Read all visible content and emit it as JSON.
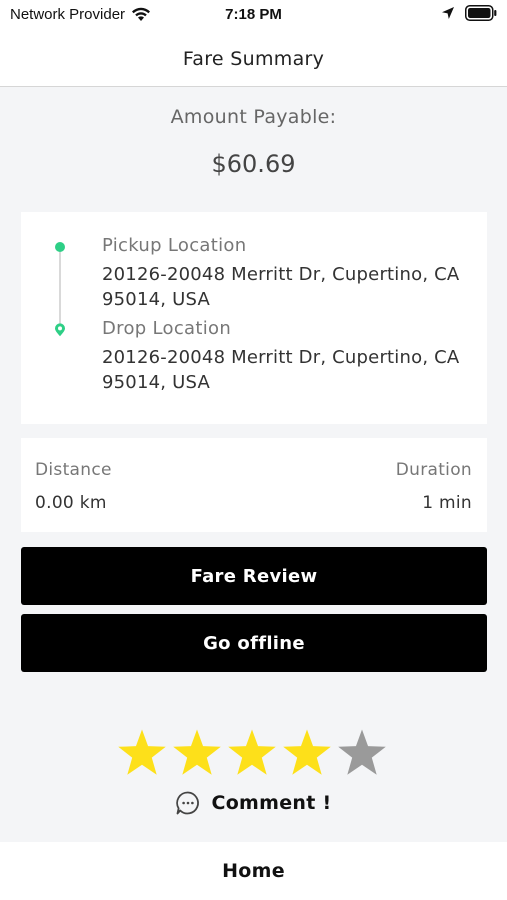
{
  "status_bar": {
    "carrier": "Network Provider",
    "time": "7:18 PM"
  },
  "header": {
    "title": "Fare Summary"
  },
  "fare": {
    "amount_label": "Amount Payable:",
    "amount_value": "$60.69"
  },
  "route": {
    "pickup_label": "Pickup Location",
    "pickup_address": "20126-20048 Merritt Dr, Cupertino, CA 95014, USA",
    "drop_label": "Drop Location",
    "drop_address": "20126-20048 Merritt Dr, Cupertino, CA 95014, USA"
  },
  "trip_stats": {
    "distance_label": "Distance",
    "distance_value": "0.00 km",
    "duration_label": "Duration",
    "duration_value": "1 min"
  },
  "actions": {
    "fare_review_label": "Fare Review",
    "go_offline_label": "Go offline"
  },
  "rating": {
    "value": 4,
    "max": 5,
    "filled_color": "#fde01a",
    "empty_color": "#9a9a9a"
  },
  "comment": {
    "label": "Comment !",
    "icon": "chat-bubble-icon"
  },
  "bottom_nav": {
    "home_label": "Home"
  },
  "colors": {
    "accent_green": "#2ecf86",
    "button_black": "#000000"
  }
}
